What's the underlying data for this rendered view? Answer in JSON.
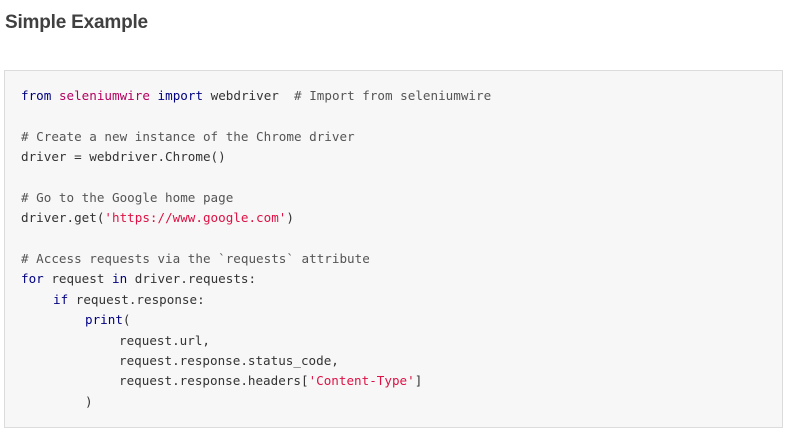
{
  "heading": "Simple Example",
  "code": {
    "line1": {
      "kw_from": "from",
      "module": "seleniumwire",
      "kw_import": "import",
      "rest": " webdriver  ",
      "comment": "# Import from seleniumwire"
    },
    "line3": {
      "comment": "# Create a new instance of the Chrome driver"
    },
    "line4": {
      "text": "driver = webdriver.Chrome()"
    },
    "line6": {
      "comment": "# Go to the Google home page"
    },
    "line7": {
      "pre": "driver.get(",
      "string": "'https://www.google.com'",
      "post": ")"
    },
    "line9": {
      "comment": "# Access requests via the `requests` attribute"
    },
    "line10": {
      "kw_for": "for",
      "mid": " request ",
      "kw_in": "in",
      "post": " driver.requests:"
    },
    "line11": {
      "kw_if": "if",
      "post": " request.response:"
    },
    "line12": {
      "kw_print": "print",
      "post": "("
    },
    "line13": {
      "text": "request.url,"
    },
    "line14": {
      "text": "request.response.status_code,"
    },
    "line15": {
      "pre": "request.response.headers[",
      "string": "'Content-Type'",
      "post": "]"
    },
    "line16": {
      "text": ")"
    }
  }
}
